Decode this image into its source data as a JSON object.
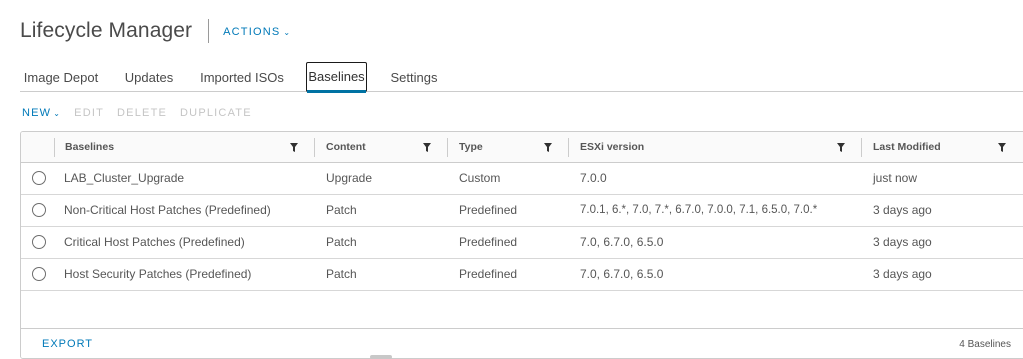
{
  "header": {
    "title": "Lifecycle Manager",
    "actions_label": "ACTIONS",
    "actions_icon": "chevron-down-icon"
  },
  "tabs": [
    {
      "label": "Image Depot",
      "active": false
    },
    {
      "label": "Updates",
      "active": false
    },
    {
      "label": "Imported ISOs",
      "active": false
    },
    {
      "label": "Baselines",
      "active": true
    },
    {
      "label": "Settings",
      "active": false
    }
  ],
  "toolbar": {
    "new_label": "NEW",
    "edit_label": "EDIT",
    "delete_label": "DELETE",
    "duplicate_label": "DUPLICATE"
  },
  "grid": {
    "columns": [
      {
        "label": "Baselines"
      },
      {
        "label": "Content"
      },
      {
        "label": "Type"
      },
      {
        "label": "ESXi version"
      },
      {
        "label": "Last Modified"
      }
    ],
    "rows": [
      {
        "name": "LAB_Cluster_Upgrade",
        "content": "Upgrade",
        "type": "Custom",
        "esxi": "7.0.0",
        "modified": "just now"
      },
      {
        "name": "Non-Critical Host Patches (Predefined)",
        "content": "Patch",
        "type": "Predefined",
        "esxi": "7.0.1, 6.*, 7.0, 7.*, 6.7.0, 7.0.0, 7.1, 6.5.0, 7.0.*",
        "modified": "3 days ago"
      },
      {
        "name": "Critical Host Patches (Predefined)",
        "content": "Patch",
        "type": "Predefined",
        "esxi": "7.0, 6.7.0, 6.5.0",
        "modified": "3 days ago"
      },
      {
        "name": "Host Security Patches (Predefined)",
        "content": "Patch",
        "type": "Predefined",
        "esxi": "7.0, 6.7.0, 6.5.0",
        "modified": "3 days ago"
      }
    ],
    "footer": {
      "export_label": "EXPORT",
      "count_label": "4 Baselines"
    }
  },
  "colors": {
    "accent": "#0079b8",
    "active_tab_underline": "#0072a3",
    "disabled_text": "#c5c5c5",
    "border": "#cccccc"
  }
}
